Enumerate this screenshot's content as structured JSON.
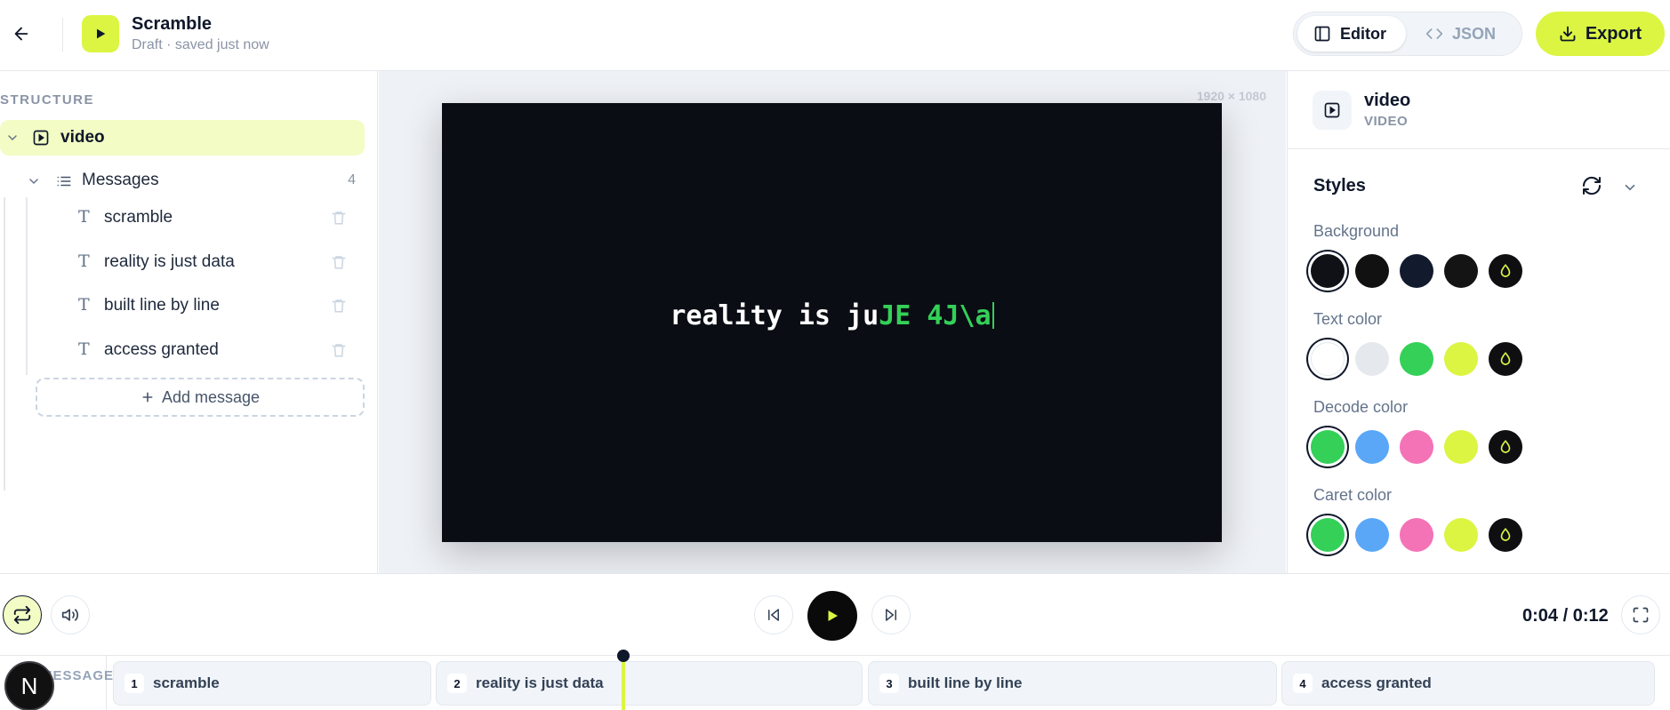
{
  "header": {
    "title": "Scramble",
    "subtitle": "Draft · saved just now",
    "mode_editor": "Editor",
    "mode_json": "JSON",
    "export_label": "Export"
  },
  "structure": {
    "section_label": "STRUCTURE",
    "root_label": "video",
    "group_label": "Messages",
    "group_count": "4",
    "messages": [
      "scramble",
      "reality is just data",
      "built line by line",
      "access granted"
    ],
    "add_label": "Add message"
  },
  "canvas": {
    "resolution": "1920 × 1080",
    "text_plain": "reality is ju",
    "text_decode": "JE 4J\\a"
  },
  "inspector": {
    "title": "video",
    "type": "VIDEO",
    "styles_title": "Styles",
    "props": [
      {
        "label": "Background",
        "swatches": [
          "#0f1117",
          "#111111",
          "#121a2e",
          "#141414"
        ],
        "selected": 0
      },
      {
        "label": "Text color",
        "swatches": [
          "#ffffff",
          "#e5e9ee",
          "#34d058",
          "#dcf542"
        ],
        "selected": 0
      },
      {
        "label": "Decode color",
        "swatches": [
          "#34d058",
          "#5aa7f7",
          "#f472b6",
          "#dcf542"
        ],
        "selected": 0
      },
      {
        "label": "Caret color",
        "swatches": [
          "#34d058",
          "#5aa7f7",
          "#f472b6",
          "#dcf542"
        ],
        "selected": 0
      }
    ]
  },
  "playback": {
    "time": "0:04 / 0:12",
    "progress_fraction": 0.333
  },
  "timeline": {
    "label": "MESSAGES",
    "badge": "N",
    "clips": [
      {
        "num": "1",
        "label": "scramble"
      },
      {
        "num": "2",
        "label": "reality is just data"
      },
      {
        "num": "3",
        "label": "built line by line"
      },
      {
        "num": "4",
        "label": "access granted"
      }
    ]
  },
  "colors": {
    "accent": "#dcf542",
    "decode": "#34d058",
    "stage_bg": "#0a0d14"
  }
}
